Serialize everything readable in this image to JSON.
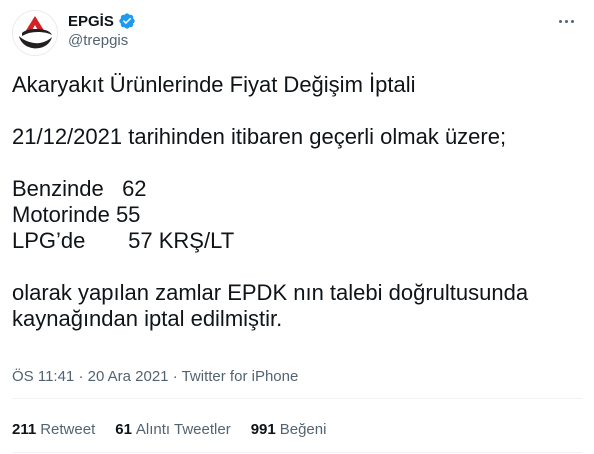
{
  "account": {
    "name": "EPGİS",
    "handle": "@trepgis"
  },
  "tweet": {
    "lines": [
      "Akaryakıt Ürünlerinde Fiyat Değişim İptali",
      "",
      "21/12/2021 tarihinden itibaren geçerli olmak üzere;",
      "",
      "Benzinde   62",
      "Motorinde 55",
      "LPG’de       57 KRŞ/LT",
      "",
      "olarak yapılan zamlar EPDK nın talebi doğrultusunda",
      "kaynağından iptal edilmiştir."
    ]
  },
  "meta": {
    "time": "ÖS 11:41",
    "date": "20 Ara 2021",
    "separator": "·",
    "source": "Twitter for iPhone"
  },
  "stats": {
    "retweets_count": "211",
    "retweets_label": "Retweet",
    "quotes_count": "61",
    "quotes_label": "Alıntı Tweetler",
    "likes_count": "991",
    "likes_label": "Beğeni"
  },
  "colors": {
    "verified": "#1d9bf0",
    "logo_red": "#d32027",
    "logo_dark": "#231f20"
  },
  "icons": [
    "epgis-logo-icon",
    "verified-badge-icon",
    "more-options-icon"
  ]
}
